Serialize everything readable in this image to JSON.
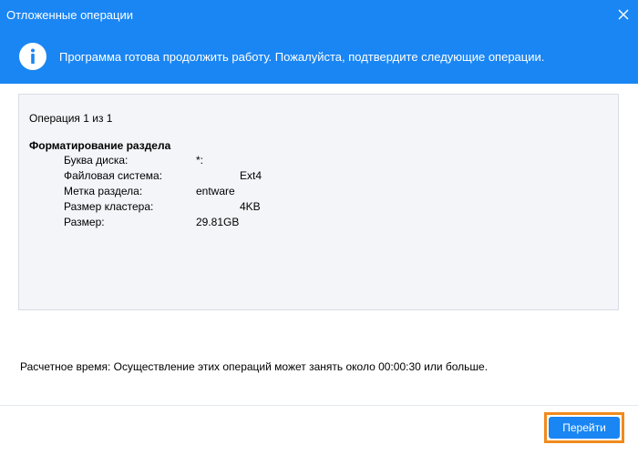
{
  "window": {
    "title": "Отложенные операции",
    "close_icon": "close-icon"
  },
  "banner": {
    "icon": "info-icon",
    "message": "Программа готова продолжить работу. Пожалуйста, подтвердите следующие операции."
  },
  "details": {
    "counter": "Операция 1 из 1",
    "operation_title": "Форматирование раздела",
    "properties": [
      {
        "label": "Буква диска:",
        "value": "*:"
      },
      {
        "label": "Файловая система:",
        "value": "Ext4"
      },
      {
        "label": "Метка раздела:",
        "value": "entware"
      },
      {
        "label": "Размер кластера:",
        "value": "4KB"
      },
      {
        "label": "Размер:",
        "value": "29.81GB"
      }
    ]
  },
  "estimate": {
    "text": "Расчетное время: Осуществление этих операций может занять около 00:00:30 или больше."
  },
  "actions": {
    "go_label": "Перейти"
  },
  "colors": {
    "accent": "#1a86f3",
    "highlight": "#f08a1c",
    "panel": "#f3f5f9"
  }
}
